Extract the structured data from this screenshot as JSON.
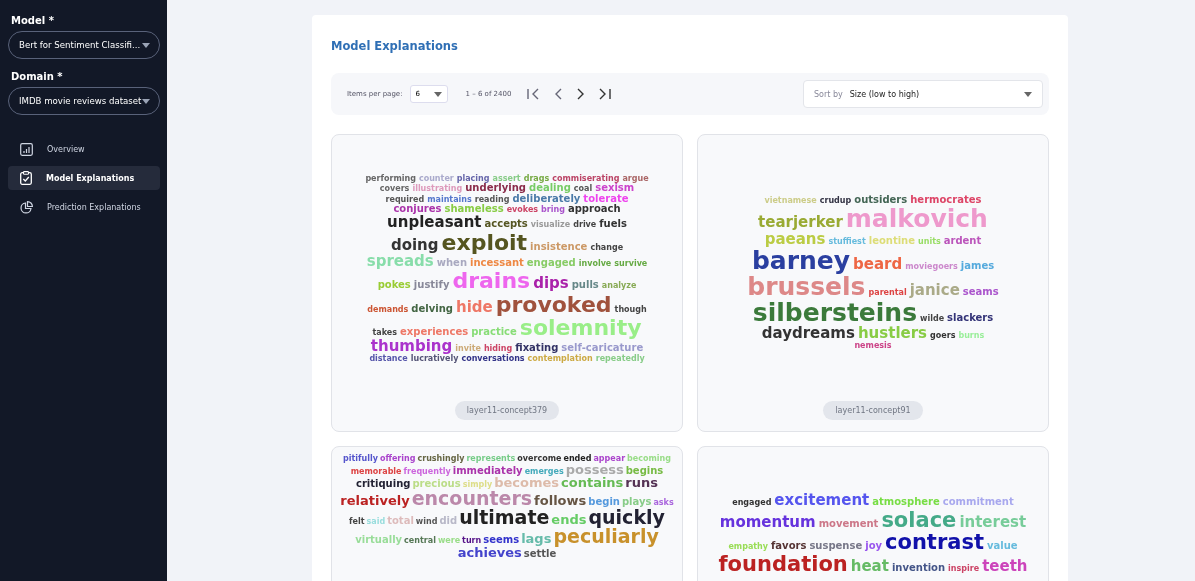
{
  "sidebar": {
    "fields": [
      {
        "label": "Model *",
        "value": "Bert for Sentiment Classifi..."
      },
      {
        "label": "Domain *",
        "value": "IMDB movie reviews dataset"
      }
    ],
    "nav": [
      {
        "label": "Overview",
        "kind": "chart",
        "selected": false
      },
      {
        "label": "Model Explanations",
        "kind": "clipboard",
        "selected": true
      },
      {
        "label": "Prediction Explanations",
        "kind": "pie",
        "selected": false
      }
    ]
  },
  "page": {
    "title": "Model Explanations"
  },
  "toolbar": {
    "items_per_page_label": "Items per page:",
    "items_per_page_value": "6",
    "range": "1 – 6 of 2400",
    "sort_label": "Sort by",
    "sort_value": "Size (low to high)"
  },
  "cards": [
    {
      "label": "layer11-concept379",
      "words": [
        {
          "text": "performing",
          "color": "#666666",
          "kind": "s"
        },
        {
          "text": "counter",
          "color": "#aaaacc",
          "kind": "s"
        },
        {
          "text": "placing",
          "color": "#6666aa",
          "kind": "s"
        },
        {
          "text": "assert",
          "color": "#88cc88",
          "kind": "s"
        },
        {
          "text": "drags",
          "color": "#77aa44",
          "kind": "s"
        },
        {
          "text": "commiserating",
          "color": "#bb4466",
          "kind": "s"
        },
        {
          "text": "argue",
          "color": "#aa6666",
          "kind": "s"
        },
        {
          "text": "covers",
          "color": "#666666",
          "kind": "s"
        },
        {
          "text": "illustrating",
          "color": "#dd99bb",
          "kind": "s"
        },
        {
          "text": "underlying",
          "color": "#8a2b4a",
          "kind": "m"
        },
        {
          "text": "dealing",
          "color": "#77cc66",
          "kind": "m"
        },
        {
          "text": "coal",
          "color": "#555555",
          "kind": "s"
        },
        {
          "text": "sexism",
          "color": "#cc44cc",
          "kind": "m"
        },
        {
          "text": "required",
          "color": "#555555",
          "kind": "s"
        },
        {
          "text": "maintains",
          "color": "#5577cc",
          "kind": "s"
        },
        {
          "text": "reading",
          "color": "#555555",
          "kind": "s"
        },
        {
          "text": "deliberately",
          "color": "#4a7aa8",
          "kind": "m"
        },
        {
          "text": "tolerate",
          "color": "#ee44ee",
          "kind": "m"
        },
        {
          "text": "conjures",
          "color": "#aa33aa",
          "kind": "m"
        },
        {
          "text": "shameless",
          "color": "#88cc44",
          "kind": "m"
        },
        {
          "text": "evokes",
          "color": "#cc4466",
          "kind": "s"
        },
        {
          "text": "bring",
          "color": "#aa55cc",
          "kind": "s"
        },
        {
          "text": "approach",
          "color": "#333333",
          "kind": "m"
        },
        {
          "text": "unpleasant",
          "color": "#222222",
          "kind": "l"
        },
        {
          "text": "accepts",
          "color": "#555522",
          "kind": "m"
        },
        {
          "text": "visualize",
          "color": "#999999",
          "kind": "s"
        },
        {
          "text": "drive",
          "color": "#444444",
          "kind": "s"
        },
        {
          "text": "fuels",
          "color": "#333333",
          "kind": "m"
        },
        {
          "text": "doing",
          "color": "#333333",
          "kind": "l"
        },
        {
          "text": "exploit",
          "color": "#555520",
          "kind": "xl"
        },
        {
          "text": "insistence",
          "color": "#cc9966",
          "kind": "m"
        },
        {
          "text": "change",
          "color": "#444444",
          "kind": "s"
        },
        {
          "text": "spreads",
          "color": "#88ddaa",
          "kind": "l"
        },
        {
          "text": "when",
          "color": "#a9a9c0",
          "kind": "m"
        },
        {
          "text": "incessant",
          "color": "#ee8844",
          "kind": "m"
        },
        {
          "text": "engaged",
          "color": "#88cc66",
          "kind": "m"
        },
        {
          "text": "involve",
          "color": "#66aa44",
          "kind": "s"
        },
        {
          "text": "survive",
          "color": "#66aa44",
          "kind": "s"
        },
        {
          "text": "pokes",
          "color": "#99cc33",
          "kind": "m"
        },
        {
          "text": "justify",
          "color": "#888899",
          "kind": "m"
        },
        {
          "text": "drains",
          "color": "#ee66ee",
          "kind": "xl"
        },
        {
          "text": "dips",
          "color": "#aa22aa",
          "kind": "l"
        },
        {
          "text": "pulls",
          "color": "#668888",
          "kind": "m"
        },
        {
          "text": "analyze",
          "color": "#88aa55",
          "kind": "s"
        },
        {
          "text": "demands",
          "color": "#cc5533",
          "kind": "s"
        },
        {
          "text": "delving",
          "color": "#446644",
          "kind": "m"
        },
        {
          "text": "hide",
          "color": "#ee7766",
          "kind": "l"
        },
        {
          "text": "provoked",
          "color": "#a0523d",
          "kind": "xl"
        },
        {
          "text": "though",
          "color": "#444444",
          "kind": "s"
        },
        {
          "text": "takes",
          "color": "#444444",
          "kind": "s"
        },
        {
          "text": "experiences",
          "color": "#ee7766",
          "kind": "m"
        },
        {
          "text": "practice",
          "color": "#88dd77",
          "kind": "m"
        },
        {
          "text": "solemnity",
          "color": "#99ee88",
          "kind": "xl"
        },
        {
          "text": "thumbing",
          "color": "#aa33cc",
          "kind": "l"
        },
        {
          "text": "invite",
          "color": "#ccaa77",
          "kind": "s"
        },
        {
          "text": "hiding",
          "color": "#cc4466",
          "kind": "s"
        },
        {
          "text": "fixating",
          "color": "#333366",
          "kind": "m"
        },
        {
          "text": "self-caricature",
          "color": "#9999cc",
          "kind": "m"
        },
        {
          "text": "distance",
          "color": "#5555aa",
          "kind": "s"
        },
        {
          "text": "lucratively",
          "color": "#555577",
          "kind": "s"
        },
        {
          "text": "conversations",
          "color": "#333388",
          "kind": "s"
        },
        {
          "text": "contemplation",
          "color": "#ccaa44",
          "kind": "s"
        },
        {
          "text": "repeatedly",
          "color": "#88cc88",
          "kind": "s"
        }
      ]
    },
    {
      "label": "layer11-concept91",
      "words": [
        {
          "text": "vietnamese",
          "color": "#cccc88",
          "kind": "s"
        },
        {
          "text": "crudup",
          "color": "#333344",
          "kind": "s"
        },
        {
          "text": "outsiders",
          "color": "#446655",
          "kind": "m"
        },
        {
          "text": "hermocrates",
          "color": "#dd4466",
          "kind": "m"
        },
        {
          "text": "tearjerker",
          "color": "#99aa33",
          "kind": "l"
        },
        {
          "text": "malkovich",
          "color": "#ee99cc",
          "kind": "xl"
        },
        {
          "text": "paeans",
          "color": "#bbcc44",
          "kind": "l"
        },
        {
          "text": "stuffiest",
          "color": "#66bbdd",
          "kind": "s"
        },
        {
          "text": "leontine",
          "color": "#dddd77",
          "kind": "m"
        },
        {
          "text": "units",
          "color": "#99dd66",
          "kind": "s"
        },
        {
          "text": "ardent",
          "color": "#bb55bb",
          "kind": "m"
        },
        {
          "text": "barney",
          "color": "#2a3fa0",
          "kind": "xl"
        },
        {
          "text": "beard",
          "color": "#ee6644",
          "kind": "l"
        },
        {
          "text": "moviegoers",
          "color": "#cc88cc",
          "kind": "s"
        },
        {
          "text": "james",
          "color": "#55aadd",
          "kind": "m"
        },
        {
          "text": "brussels",
          "color": "#dd8888",
          "kind": "xl"
        },
        {
          "text": "parental",
          "color": "#dd4444",
          "kind": "s"
        },
        {
          "text": "janice",
          "color": "#aaaa88",
          "kind": "l"
        },
        {
          "text": "seams",
          "color": "#aa55cc",
          "kind": "m"
        },
        {
          "text": "silbersteins",
          "color": "#3b7a3b",
          "kind": "xl"
        },
        {
          "text": "wilde",
          "color": "#444444",
          "kind": "s"
        },
        {
          "text": "slackers",
          "color": "#333377",
          "kind": "m"
        },
        {
          "text": "daydreams",
          "color": "#333333",
          "kind": "l"
        },
        {
          "text": "hustlers",
          "color": "#88cc44",
          "kind": "l"
        },
        {
          "text": "goers",
          "color": "#333333",
          "kind": "s"
        },
        {
          "text": "burns",
          "color": "#99ee99",
          "kind": "s"
        },
        {
          "text": "nemesis",
          "color": "#cc4488",
          "kind": "s"
        }
      ]
    },
    {
      "words": [
        {
          "text": "pitifully",
          "color": "#5555cc",
          "kind": "s"
        },
        {
          "text": "offering",
          "color": "#aa44cc",
          "kind": "s"
        },
        {
          "text": "crushingly",
          "color": "#666644",
          "kind": "s"
        },
        {
          "text": "represents",
          "color": "#77cc88",
          "kind": "s"
        },
        {
          "text": "overcome",
          "color": "#333333",
          "kind": "s"
        },
        {
          "text": "ended",
          "color": "#222222",
          "kind": "s"
        },
        {
          "text": "appear",
          "color": "#aa44cc",
          "kind": "s"
        },
        {
          "text": "becoming",
          "color": "#99dd88",
          "kind": "s"
        },
        {
          "text": "memorable",
          "color": "#dd4444",
          "kind": "s"
        },
        {
          "text": "frequently",
          "color": "#cc66dd",
          "kind": "s"
        },
        {
          "text": "immediately",
          "color": "#aa33aa",
          "kind": "m"
        },
        {
          "text": "emerges",
          "color": "#44aabb",
          "kind": "s"
        },
        {
          "text": "possess",
          "color": "#aaaaaa",
          "kind": "l"
        },
        {
          "text": "begins",
          "color": "#77bb44",
          "kind": "m"
        },
        {
          "text": "critiquing",
          "color": "#222233",
          "kind": "m"
        },
        {
          "text": "precious",
          "color": "#bbdd88",
          "kind": "m"
        },
        {
          "text": "simply",
          "color": "#dddd88",
          "kind": "s"
        },
        {
          "text": "becomes",
          "color": "#ddbbaa",
          "kind": "l"
        },
        {
          "text": "contains",
          "color": "#66bb55",
          "kind": "l"
        },
        {
          "text": "runs",
          "color": "#553355",
          "kind": "l"
        },
        {
          "text": "relatively",
          "color": "#bb2222",
          "kind": "l"
        },
        {
          "text": "encounters",
          "color": "#bb88aa",
          "kind": "xl"
        },
        {
          "text": "follows",
          "color": "#665544",
          "kind": "l"
        },
        {
          "text": "begin",
          "color": "#5599dd",
          "kind": "m"
        },
        {
          "text": "plays",
          "color": "#88cc88",
          "kind": "m"
        },
        {
          "text": "asks",
          "color": "#aa66dd",
          "kind": "s"
        },
        {
          "text": "felt",
          "color": "#444444",
          "kind": "s"
        },
        {
          "text": "said",
          "color": "#99dddd",
          "kind": "s"
        },
        {
          "text": "total",
          "color": "#ddbbbb",
          "kind": "m"
        },
        {
          "text": "wind",
          "color": "#555555",
          "kind": "s"
        },
        {
          "text": "did",
          "color": "#b8b8c8",
          "kind": "m"
        },
        {
          "text": "ultimate",
          "color": "#222222",
          "kind": "xl"
        },
        {
          "text": "ends",
          "color": "#66cc66",
          "kind": "l"
        },
        {
          "text": "quickly",
          "color": "#222233",
          "kind": "xl"
        },
        {
          "text": "virtually",
          "color": "#99dd99",
          "kind": "m"
        },
        {
          "text": "central",
          "color": "#557755",
          "kind": "s"
        },
        {
          "text": "were",
          "color": "#99dd88",
          "kind": "s"
        },
        {
          "text": "turn",
          "color": "#551188",
          "kind": "s"
        },
        {
          "text": "seems",
          "color": "#3333cc",
          "kind": "m"
        },
        {
          "text": "lags",
          "color": "#66bbaa",
          "kind": "l"
        },
        {
          "text": "peculiarly",
          "color": "#c8912b",
          "kind": "xl"
        },
        {
          "text": "achieves",
          "color": "#4444cc",
          "kind": "l"
        },
        {
          "text": "settle",
          "color": "#555555",
          "kind": "m"
        }
      ]
    },
    {
      "words": [
        {
          "text": "engaged",
          "color": "#333333",
          "kind": "s"
        },
        {
          "text": "excitement",
          "color": "#5555ee",
          "kind": "l"
        },
        {
          "text": "atmosphere",
          "color": "#77dd44",
          "kind": "m"
        },
        {
          "text": "commitment",
          "color": "#a8a8ee",
          "kind": "m"
        },
        {
          "text": "momentum",
          "color": "#6633dd",
          "kind": "l"
        },
        {
          "text": "movement",
          "color": "#cc7788",
          "kind": "m"
        },
        {
          "text": "solace",
          "color": "#44aa88",
          "kind": "xl"
        },
        {
          "text": "interest",
          "color": "#77cc99",
          "kind": "l"
        },
        {
          "text": "empathy",
          "color": "#99dd55",
          "kind": "s"
        },
        {
          "text": "favors",
          "color": "#553333",
          "kind": "m"
        },
        {
          "text": "suspense",
          "color": "#777788",
          "kind": "m"
        },
        {
          "text": "joy",
          "color": "#9955ee",
          "kind": "m"
        },
        {
          "text": "contrast",
          "color": "#1111aa",
          "kind": "xl"
        },
        {
          "text": "value",
          "color": "#66bbdd",
          "kind": "m"
        },
        {
          "text": "foundation",
          "color": "#bb2222",
          "kind": "xl"
        },
        {
          "text": "heat",
          "color": "#66bb66",
          "kind": "l"
        },
        {
          "text": "invention",
          "color": "#445588",
          "kind": "m"
        },
        {
          "text": "inspire",
          "color": "#cc4466",
          "kind": "s"
        },
        {
          "text": "teeth",
          "color": "#cc44bb",
          "kind": "l"
        }
      ]
    }
  ]
}
